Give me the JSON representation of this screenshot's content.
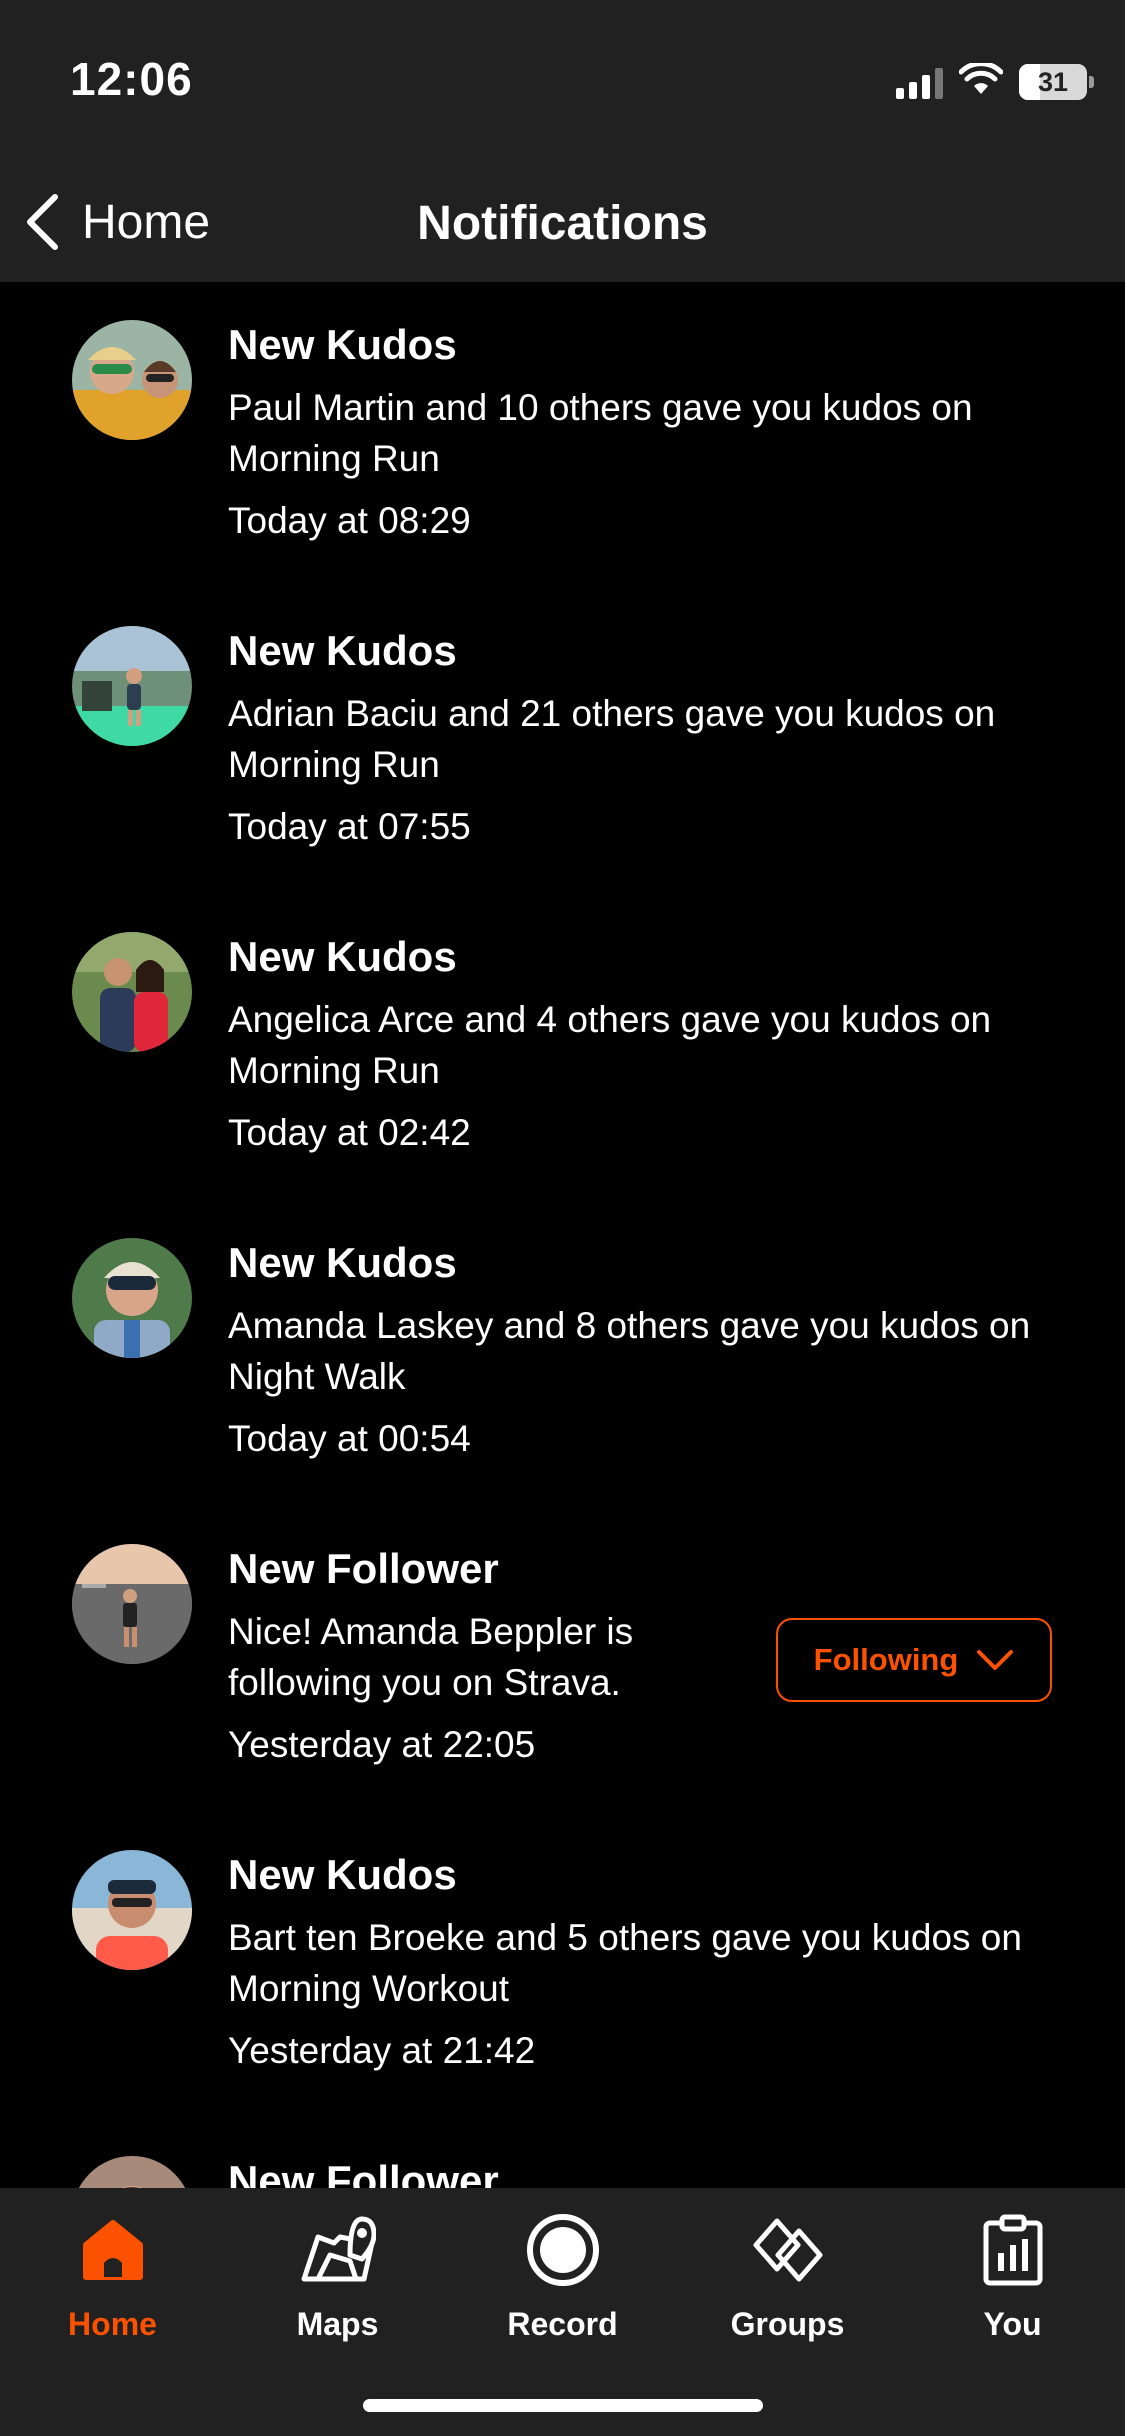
{
  "status_bar": {
    "time": "12:06",
    "battery": "31",
    "battery_level": 0.31
  },
  "header": {
    "back_label": "Home",
    "title": "Notifications"
  },
  "notifications": [
    {
      "title": "New Kudos",
      "body": "Paul Martin and 10 others gave you kudos on Morning Run",
      "time": "Today at 08:29"
    },
    {
      "title": "New Kudos",
      "body": "Adrian Baciu and 21 others gave you kudos on Morning Run",
      "time": "Today at 07:55"
    },
    {
      "title": "New Kudos",
      "body": "Angelica Arce and 4 others gave you kudos on Morning Run",
      "time": "Today at 02:42"
    },
    {
      "title": "New Kudos",
      "body": "Amanda Laskey and 8 others gave you kudos on Night Walk",
      "time": "Today at 00:54"
    },
    {
      "title": "New Follower",
      "body": "Nice! Amanda Beppler is following you on Strava.",
      "time": "Yesterday at 22:05",
      "button": "Following"
    },
    {
      "title": "New Kudos",
      "body": "Bart ten Broeke and 5 others gave you kudos on Morning Workout",
      "time": "Yesterday at 21:42"
    },
    {
      "title": "New Follower"
    }
  ],
  "tabs": [
    {
      "label": "Home",
      "icon": "home-icon",
      "active": true
    },
    {
      "label": "Maps",
      "icon": "maps-icon"
    },
    {
      "label": "Record",
      "icon": "record-icon"
    },
    {
      "label": "Groups",
      "icon": "groups-icon"
    },
    {
      "label": "You",
      "icon": "you-icon"
    }
  ],
  "colors": {
    "accent": "#fc5200",
    "background": "#000000",
    "bar": "#212121"
  }
}
